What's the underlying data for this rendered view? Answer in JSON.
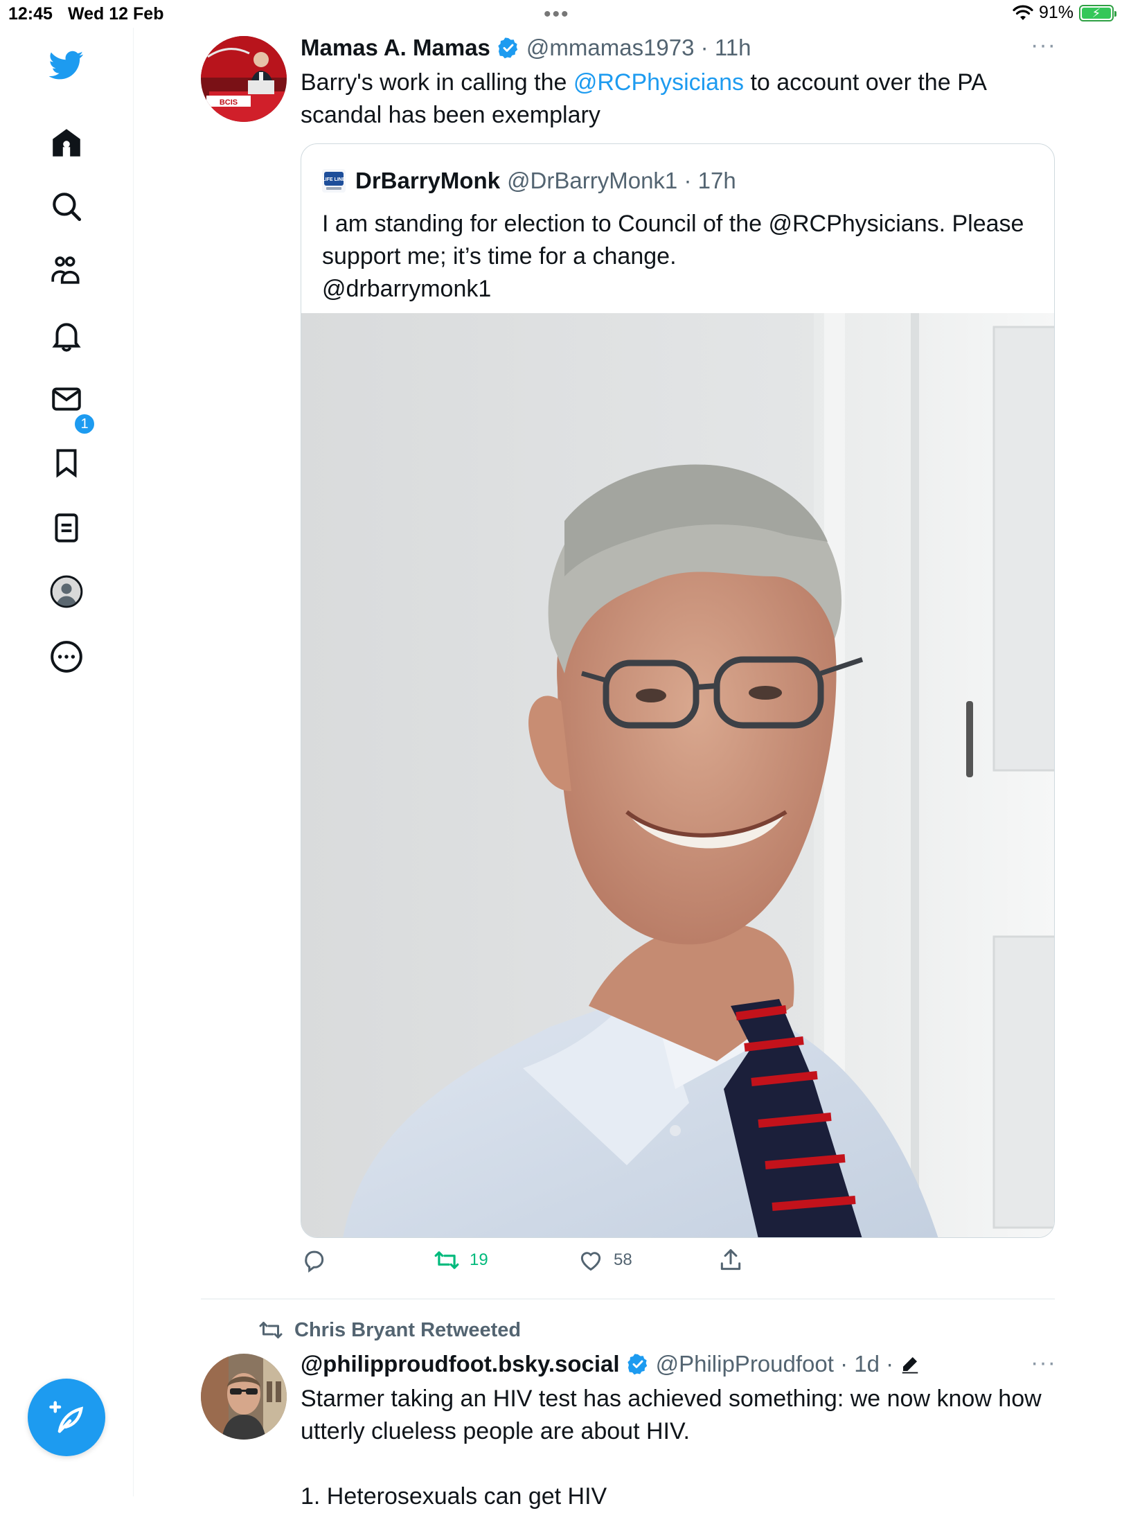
{
  "status_bar": {
    "time": "12:45",
    "date": "Wed 12 Feb",
    "multitask": "•••",
    "battery_percent": "91%"
  },
  "sidebar": {
    "items": [
      {
        "icon": "twitter-logo-icon"
      },
      {
        "icon": "home-icon"
      },
      {
        "icon": "search-icon"
      },
      {
        "icon": "communities-icon"
      },
      {
        "icon": "notifications-icon",
        "badge": "1"
      },
      {
        "icon": "messages-icon"
      },
      {
        "icon": "bookmarks-icon"
      },
      {
        "icon": "lists-icon"
      },
      {
        "icon": "profile-icon"
      },
      {
        "icon": "more-icon"
      }
    ],
    "compose_icon": "compose-tweet-icon"
  },
  "tweet1": {
    "display_name": "Mamas A. Mamas",
    "handle": "@mmamas1973",
    "time": "11h",
    "avatar_caption": "BCIS",
    "text_before": "Barry's work in calling the ",
    "mention": "@RCPhysicians",
    "text_after": " to account over the PA scandal has been exemplary",
    "more": "···",
    "quote": {
      "display_name": "DrBarryMonk",
      "handle": "@DrBarryMonk1",
      "time": "17h",
      "logo_text": "LIFE LINE",
      "text_line1": "I am standing for election to Council of the @RCPhysicians. Please",
      "text_line2": "support me; it’s time for a change.",
      "text_line3": "@drbarrymonk1"
    },
    "actions": {
      "reply_count": "",
      "retweet_count": "19",
      "like_count": "58"
    }
  },
  "tweet2": {
    "social_context": "Chris Bryant Retweeted",
    "display_name": "@philipproudfoot.bsky.social",
    "handle": "@PhilipProudfoot",
    "time": "1d",
    "more": "···",
    "text_line1": "Starmer taking an HIV test has achieved something: we now know how",
    "text_line2": "utterly clueless people are about HIV.",
    "text_line3": "1. Heterosexuals can get HIV"
  },
  "colors": {
    "accent": "#1d9bf0",
    "retweet_green": "#00ba7c",
    "text_primary": "#0f1419",
    "text_secondary": "#536471"
  }
}
